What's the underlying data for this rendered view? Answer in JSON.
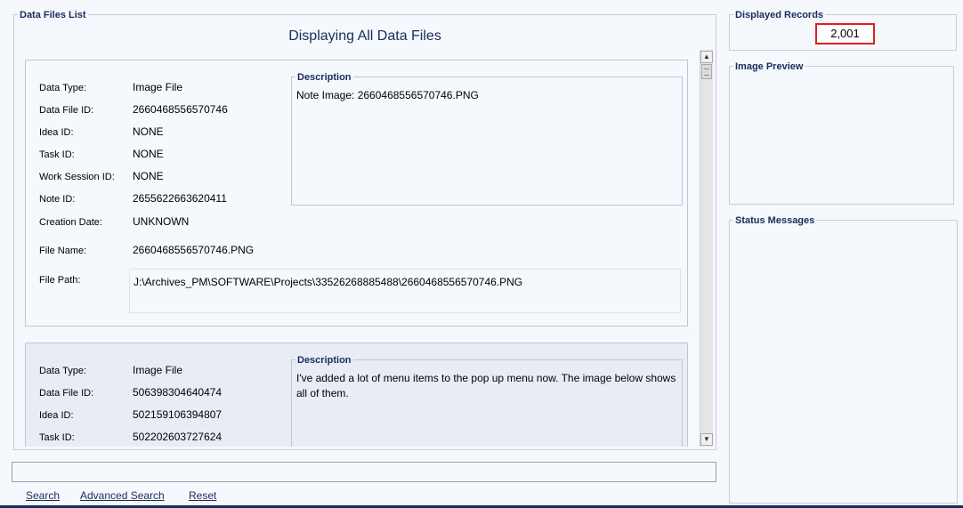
{
  "data_files_list": {
    "legend": "Data Files List",
    "title": "Displaying All Data Files"
  },
  "field_labels": {
    "data_type": "Data Type:",
    "data_file_id": "Data File ID:",
    "idea_id": "Idea ID:",
    "task_id": "Task ID:",
    "work_session_id": "Work Session ID:",
    "note_id": "Note ID:",
    "creation_date": "Creation Date:",
    "file_name": "File Name:",
    "file_path": "File Path:",
    "description": "Description"
  },
  "records": [
    {
      "data_type": "Image File",
      "data_file_id": "2660468556570746",
      "idea_id": "NONE",
      "task_id": "NONE",
      "work_session_id": "NONE",
      "note_id": "2655622663620411",
      "creation_date": "UNKNOWN",
      "file_name": "2660468556570746.PNG",
      "file_path": "J:\\Archives_PM\\SOFTWARE\\Projects\\33526268885488\\2660468556570746.PNG",
      "description": "Note Image: 2660468556570746.PNG"
    },
    {
      "data_type": "Image File",
      "data_file_id": "506398304640474",
      "idea_id": "502159106394807",
      "task_id": "502202603727624",
      "description": "I've added a lot of menu items to the pop up menu now. The image below shows all of them."
    }
  ],
  "search_bar": {
    "value": "",
    "search_label": "Search",
    "advanced_label": "Advanced Search",
    "reset_label": "Reset"
  },
  "displayed_records": {
    "legend": "Displayed Records",
    "value": "2,001"
  },
  "image_preview": {
    "legend": "Image Preview"
  },
  "status_messages": {
    "legend": "Status Messages"
  },
  "scrollbar": {
    "up_icon": "▲",
    "down_icon": "▼"
  }
}
